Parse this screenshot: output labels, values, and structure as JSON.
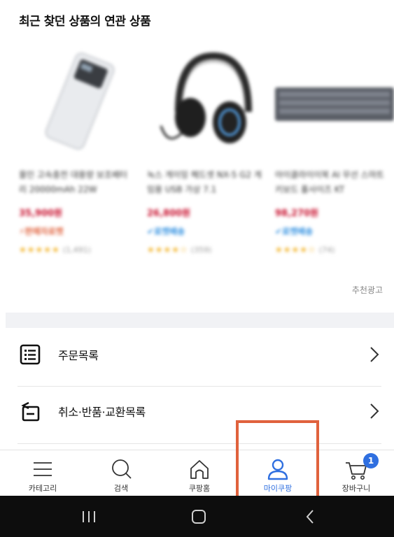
{
  "section": {
    "title": "최근 찾던 상품의 연관 상품"
  },
  "products": [
    {
      "name": "올인 고속충전 대용량 보조배터리 20000mAh 22W",
      "price": "35,900원",
      "badge": "⚡판매자로켓",
      "badge_color": "#e0623d",
      "stars": "★★★★★",
      "reviews": "(1,491)"
    },
    {
      "name": "녹스 게이밍 헤드셋 NX-5 G2 게임용 USB 가상 7.1",
      "price": "26,800원",
      "badge": "✔로켓배송",
      "badge_color": "#2f8fe0",
      "stars": "★★★★☆",
      "reviews": "(359)"
    },
    {
      "name": "아이클라이이북 AI 무선 스마트 키보드 풀사이즈 KT",
      "price": "98,270원",
      "badge": "✔로켓배송",
      "badge_color": "#2f8fe0",
      "stars": "★★★★☆",
      "reviews": "(74)"
    }
  ],
  "ad_label": "추천광고",
  "menu": [
    {
      "label": "주문목록",
      "icon": "list-icon"
    },
    {
      "label": "취소·반품·교환목록",
      "icon": "return-icon"
    }
  ],
  "tabs": [
    {
      "label": "카테고리",
      "icon": "menu-icon"
    },
    {
      "label": "검색",
      "icon": "search-icon"
    },
    {
      "label": "쿠팡홈",
      "icon": "home-icon"
    },
    {
      "label": "마이쿠팡",
      "icon": "user-icon",
      "active": true
    },
    {
      "label": "장바구니",
      "icon": "cart-icon",
      "badge": "1"
    }
  ],
  "colors": {
    "accent": "#2f6fe0",
    "highlight": "#e0623d",
    "price": "#c8102e"
  }
}
